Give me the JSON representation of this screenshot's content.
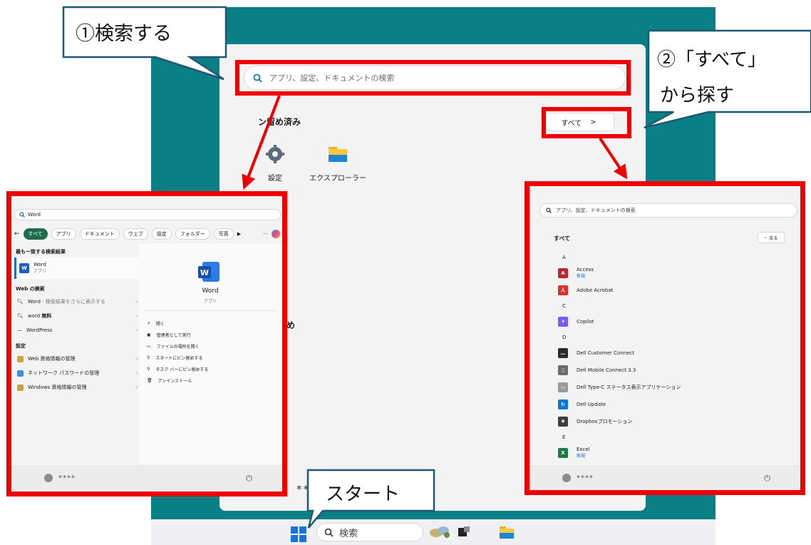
{
  "callouts": {
    "search": "①検索する",
    "all_line1": "②「すべて」",
    "all_line2": "から探す",
    "start": "スタート"
  },
  "start_menu": {
    "search_placeholder": "アプリ、設定、ドキュメントの検索",
    "pinned_title": "ピン留め済み",
    "pinned_title_visible": "ン留め済み",
    "all_button": "すべて",
    "all_chevron": ">",
    "pinned_apps": [
      {
        "label": "設定",
        "icon": "gear-icon"
      },
      {
        "label": "エクスプローラー",
        "icon": "folder-icon"
      }
    ],
    "recommended_fragment": "め",
    "user_fragment": "**"
  },
  "taskbar": {
    "search_label": "検索"
  },
  "search_panel": {
    "query": "Word",
    "filters": [
      "すべて",
      "アプリ",
      "ドキュメント",
      "ウェブ",
      "設定",
      "フォルダー",
      "写真"
    ],
    "more": "···",
    "best_match_title": "最も一致する検索結果",
    "best_match": {
      "name": "Word",
      "type": "アプリ"
    },
    "web_title": "Web の検索",
    "web_items": [
      {
        "text": "Word",
        "suffix": " - 検索結果をさらに表示する"
      },
      {
        "text": "word ",
        "bold": "無料"
      },
      {
        "text": "WordPress",
        "suffix": ""
      }
    ],
    "settings_title": "設定",
    "settings_items": [
      "Web 資格情報の管理",
      "ネットワーク パスワードの管理",
      "Windows 資格情報の管理"
    ],
    "preview": {
      "name": "Word",
      "type": "アプリ",
      "actions": [
        "開く",
        "管理者として実行",
        "ファイルの場所を開く",
        "スタートにピン留めする",
        "タスク バーにピン留めする",
        "アンインストール"
      ]
    },
    "user": "****",
    "power_icon": "power-icon"
  },
  "all_panel": {
    "search_placeholder": "アプリ、設定、ドキュメントの検索",
    "title": "すべて",
    "back": "戻る",
    "list": [
      {
        "letter": "A"
      },
      {
        "name": "Access",
        "badge": "新規",
        "icon": "access-icon",
        "color": "#b7282e",
        "glyph": "A"
      },
      {
        "name": "Adobe Acrobat",
        "icon": "acrobat-icon",
        "color": "#d0342c",
        "glyph": "人"
      },
      {
        "letter": "C"
      },
      {
        "name": "Copilot",
        "icon": "copilot-icon",
        "color": "#7a5cf0",
        "glyph": "✦"
      },
      {
        "letter": "D"
      },
      {
        "name": "Dell Customer Connect",
        "icon": "chat-icon",
        "color": "#2b2b2b",
        "glyph": "…"
      },
      {
        "name": "Dell Mobile Connect 3.3",
        "icon": "phone-icon",
        "color": "#6b6b6b",
        "glyph": "▯"
      },
      {
        "name": "Dell Type-C ステータス表示アプリケーション",
        "icon": "usb-icon",
        "color": "#9a9a9a",
        "glyph": "▭"
      },
      {
        "name": "Dell Update",
        "icon": "update-icon",
        "color": "#0a78d4",
        "glyph": "↻"
      },
      {
        "name": "Dropboxプロモーション",
        "icon": "dropbox-icon",
        "color": "#3c3c3c",
        "glyph": "❖"
      },
      {
        "letter": "E"
      },
      {
        "name": "Excel",
        "badge": "新規",
        "icon": "excel-icon",
        "color": "#1d7a45",
        "glyph": "X"
      }
    ],
    "user": "****"
  }
}
